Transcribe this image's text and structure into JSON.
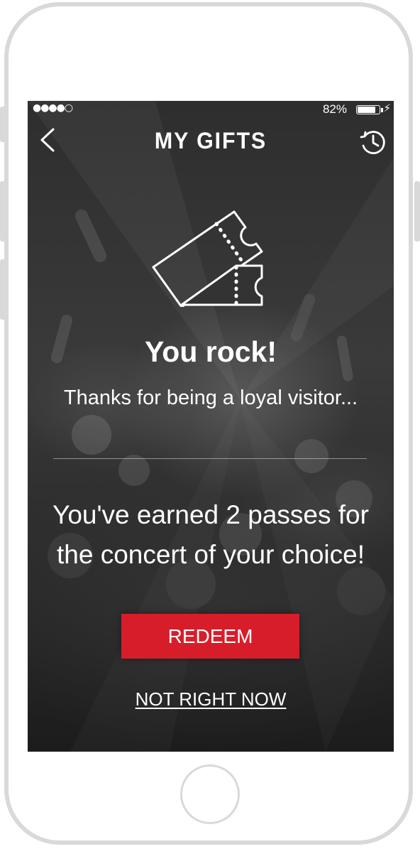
{
  "status_bar": {
    "signal": "●●●●○",
    "battery_percent": "82%",
    "battery_level": 0.82,
    "charging_symbol": "⚡"
  },
  "nav": {
    "title": "MY GIFTS",
    "back_icon": "chevron-left-icon",
    "history_icon": "history-clock-icon"
  },
  "main": {
    "icon": "ticket-icon",
    "headline": "You rock!",
    "subline": "Thanks for being a loyal visitor...",
    "message_line1": "You've earned 2 passes for",
    "message_line2": "the concert of your choice!"
  },
  "actions": {
    "redeem_label": "REDEEM",
    "dismiss_label": "NOT RIGHT NOW"
  },
  "colors": {
    "accent": "#d81d2a",
    "text": "#ffffff",
    "device_frame": "#d9d9d9"
  }
}
